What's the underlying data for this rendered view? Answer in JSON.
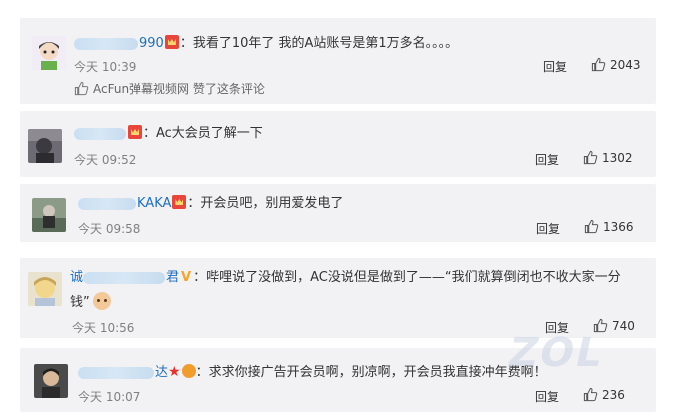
{
  "comments": [
    {
      "username_suffix": "990",
      "text": "：我看了10年了 我的A站账号是第1万多名。。。。",
      "time": "今天 10:39",
      "reply_label": "回复",
      "likes": "2043",
      "liked_by": "AcFun弹幕视频网 赞了这条评论"
    },
    {
      "username_suffix": "",
      "text": "：Ac大会员了解一下",
      "time": "今天 09:52",
      "reply_label": "回复",
      "likes": "1302"
    },
    {
      "username_suffix": "KAKA",
      "text": "：开会员吧，别用爱发电了",
      "time": "今天 09:58",
      "reply_label": "回复",
      "likes": "1366"
    },
    {
      "username_suffix": "君",
      "text": "：哔哩说了没做到，AC没说但是做到了——“我们就算倒闭也不收大家一分",
      "text_line2": "钱”",
      "time": "今天 10:56",
      "reply_label": "回复",
      "likes": "740"
    },
    {
      "username_suffix": "达",
      "text": "：求求你接广告开会员啊，别凉啊，开会员我直接冲年费啊！",
      "time": "今天 10:07",
      "reply_label": "回复",
      "likes": "236"
    }
  ],
  "watermark": "ZOL",
  "colors": {
    "card_bg": "#f2f2f5",
    "username_link": "#1e6fbf",
    "badge_red": "#e9463b"
  }
}
